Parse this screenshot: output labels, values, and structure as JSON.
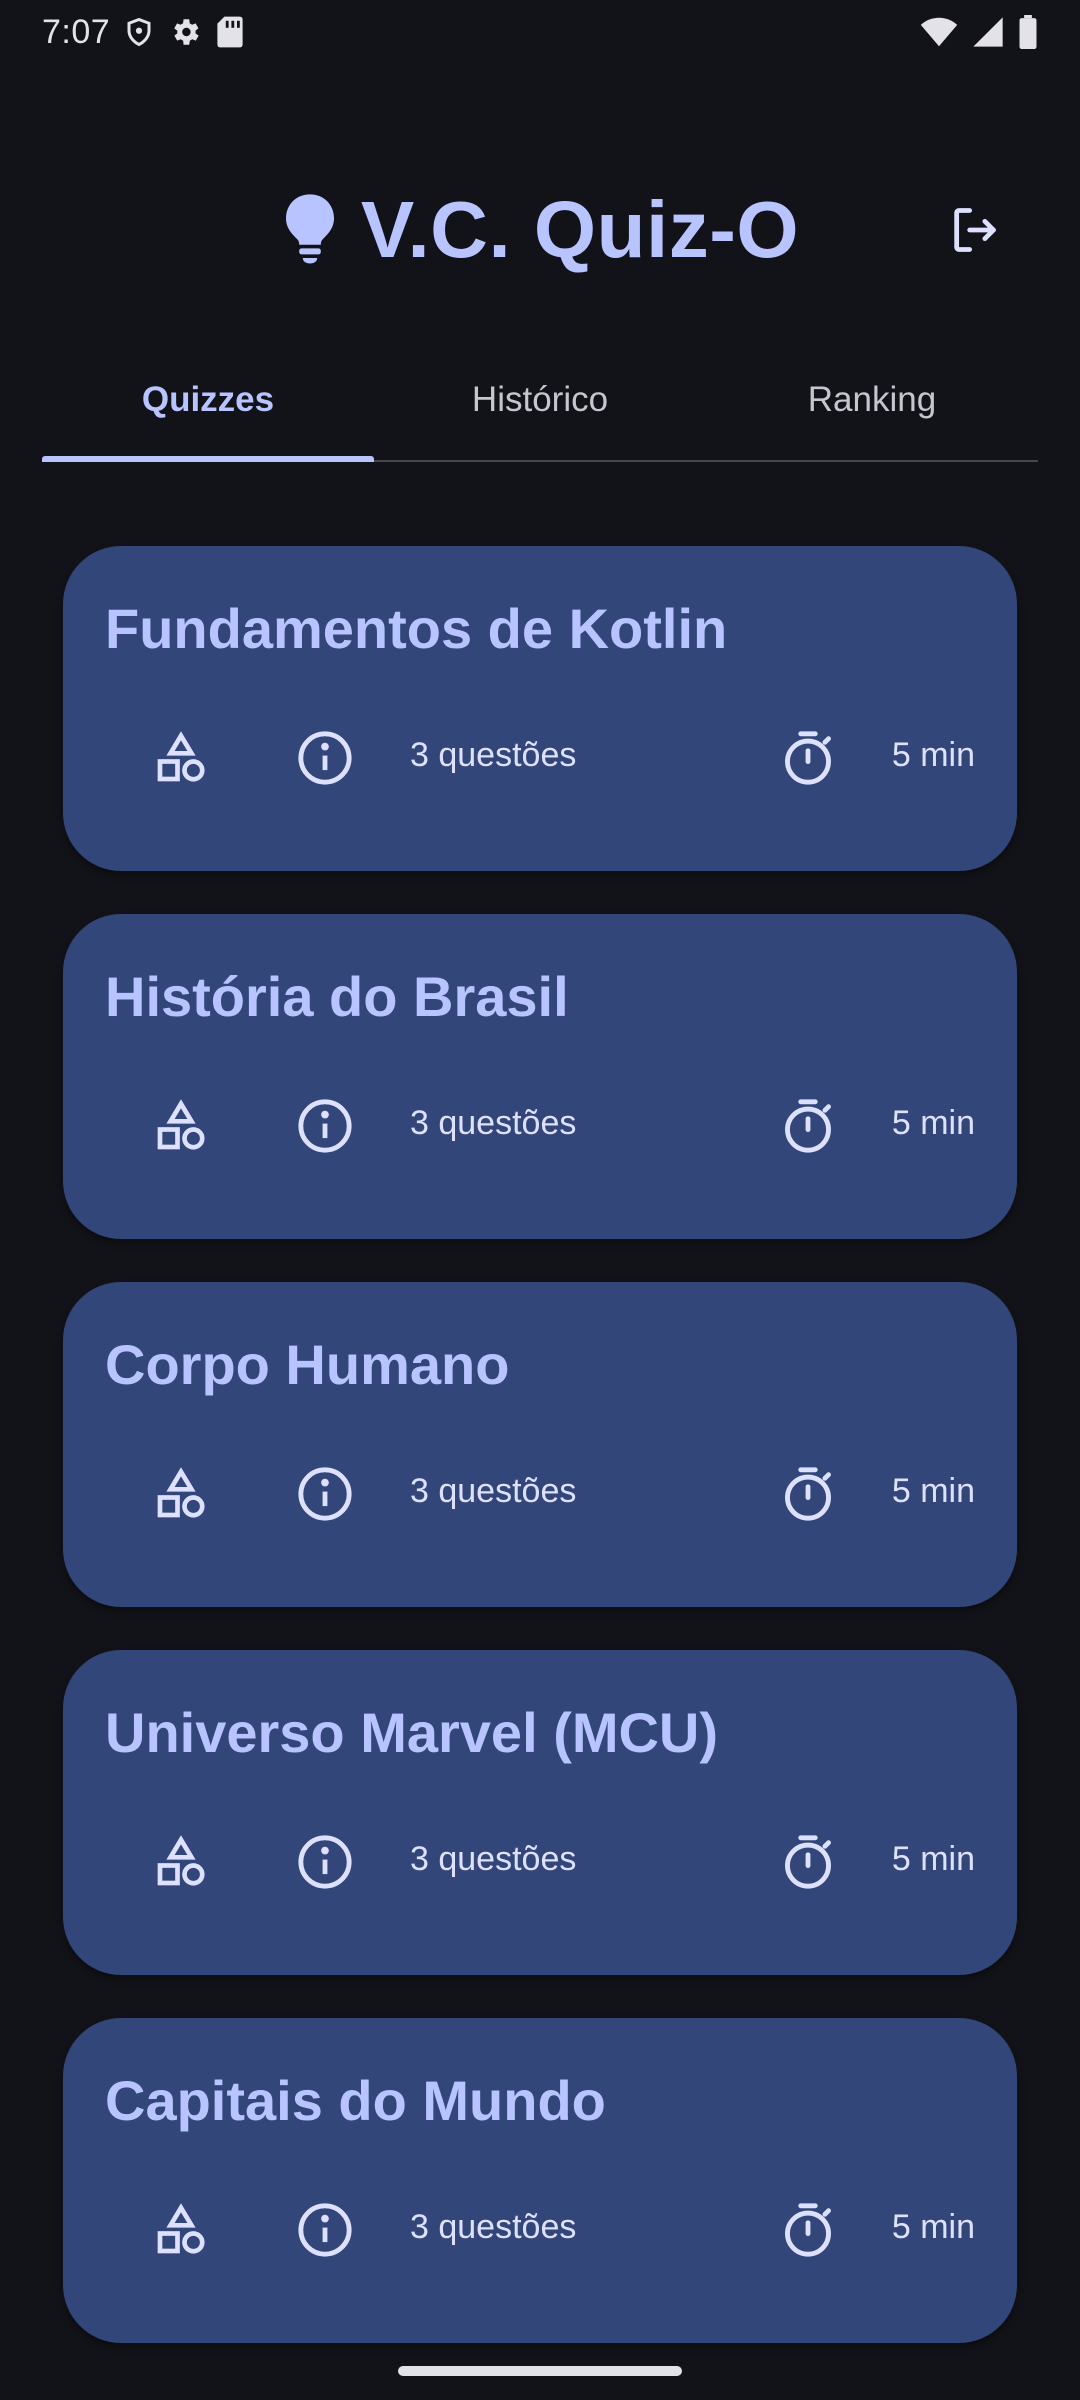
{
  "status_bar": {
    "time": "7:07"
  },
  "header": {
    "title": "V.C. Quiz-O"
  },
  "tabs": [
    {
      "label": "Quizzes",
      "active": true
    },
    {
      "label": "Histórico",
      "active": false
    },
    {
      "label": "Ranking",
      "active": false
    }
  ],
  "quizzes": [
    {
      "title": "Fundamentos de Kotlin",
      "questions": "3 questões",
      "time": "5 min"
    },
    {
      "title": "História do Brasil",
      "questions": "3 questões",
      "time": "5 min"
    },
    {
      "title": "Corpo Humano",
      "questions": "3 questões",
      "time": "5 min"
    },
    {
      "title": "Universo Marvel (MCU)",
      "questions": "3 questões",
      "time": "5 min"
    },
    {
      "title": "Capitais do Mundo",
      "questions": "3 questões",
      "time": "5 min"
    }
  ],
  "icons": {
    "logo": "lightbulb-icon",
    "logout": "logout-icon",
    "category": "shapes-icon",
    "info": "info-icon",
    "timer": "timer-icon"
  },
  "colors": {
    "background": "#121318",
    "accent": "#b8c4ff",
    "card": "#33467a",
    "text": "#dde1ff"
  }
}
